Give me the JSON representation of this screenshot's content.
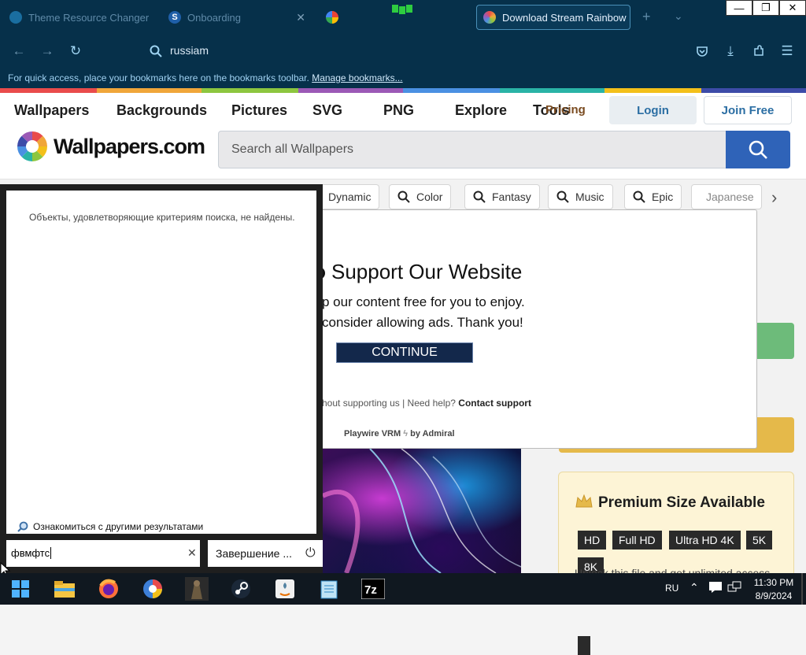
{
  "browser": {
    "tabs": [
      {
        "label": "Theme Resource Changer",
        "icon": "theme-favicon",
        "active": false
      },
      {
        "label": "Onboarding",
        "icon": "s-favicon",
        "active": false
      },
      {
        "label": "",
        "icon": "google-favicon",
        "active": false
      },
      {
        "label": "Download Stream Rainbow",
        "icon": "rainbow-favicon",
        "active": true
      }
    ],
    "new_tab": "+",
    "address": "russiam",
    "bookmark_hint": "For quick access, place your bookmarks here on the bookmarks toolbar.",
    "bookmark_link": "Manage bookmarks...",
    "window_controls": [
      "—",
      "❐",
      "✕"
    ]
  },
  "site": {
    "menu": [
      "Wallpapers",
      "Backgrounds",
      "Pictures",
      "SVG",
      "PNG",
      "Explore",
      "Tools"
    ],
    "pricing": "Pricing",
    "login": "Login",
    "join": "Join Free",
    "logo": "Wallpapers.com",
    "search_placeholder": "Search all Wallpapers",
    "chips": [
      "Dynamic",
      "Color",
      "Fantasy",
      "Music",
      "Epic",
      "Japanese"
    ],
    "premium": {
      "title": "Premium Size Available",
      "sizes": [
        "HD",
        "Full HD",
        "Ultra HD 4K",
        "5K",
        "8K"
      ],
      "unlock": "Unlock this file and get unlimited access"
    }
  },
  "modal": {
    "title": "Support Our Website",
    "line1": "p our content free for you to enjoy.",
    "line2": "consider allowing ads. Thank you!",
    "continue": "CONTINUE",
    "foot_prefix": "hout supporting us",
    "help": "Need help?",
    "support": "Contact support",
    "brand": "Playwire VRM",
    "by": "by Admiral"
  },
  "start_search": {
    "no_results": "Объекты, удовлетворяющие критериям поиска, не найдены.",
    "more_results": "Ознакомиться с другими результатами",
    "query": "фвмфтс",
    "shutdown": "Завершение ..."
  },
  "taskbar": {
    "apps": [
      "file-explorer-icon",
      "firefox-icon",
      "browser-icon",
      "game-icon",
      "steam-icon",
      "java-icon",
      "notepad-icon",
      "7zip-icon"
    ],
    "lang": "RU",
    "time": "11:30 PM",
    "date": "8/9/2024",
    "colors": {
      "accent": "#2f63b8",
      "taskbar": "#101820",
      "tabbar": "#06304a"
    }
  }
}
